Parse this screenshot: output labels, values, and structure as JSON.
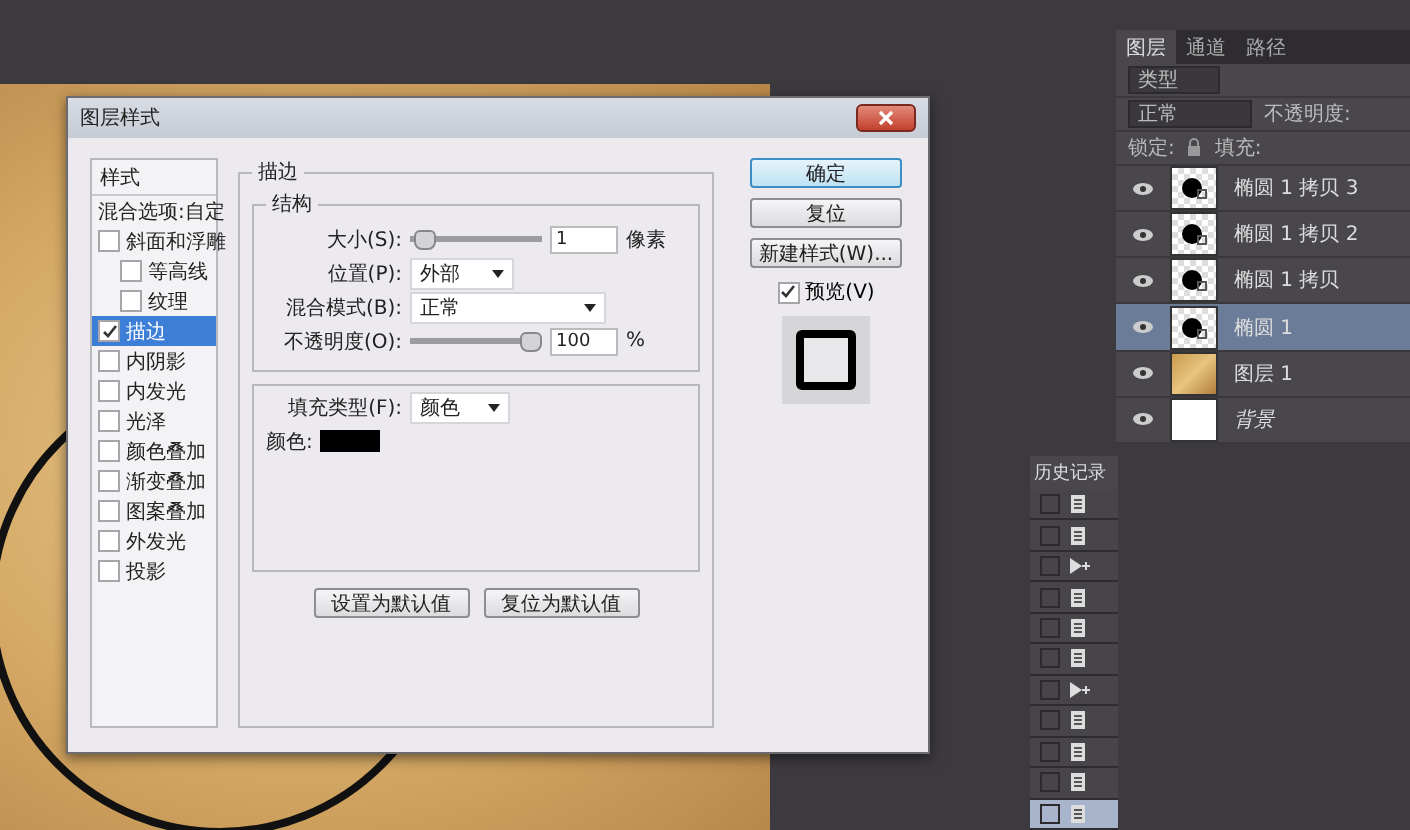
{
  "dialog": {
    "title": "图层样式",
    "styles_header": "样式",
    "blend_options": "混合选项:自定",
    "effects": [
      {
        "label": "斜面和浮雕",
        "checked": false,
        "selected": false,
        "children": [
          {
            "label": "等高线",
            "checked": false,
            "selected": false
          },
          {
            "label": "纹理",
            "checked": false,
            "selected": false
          }
        ]
      },
      {
        "label": "描边",
        "checked": true,
        "selected": true
      },
      {
        "label": "内阴影",
        "checked": false,
        "selected": false
      },
      {
        "label": "内发光",
        "checked": false,
        "selected": false
      },
      {
        "label": "光泽",
        "checked": false,
        "selected": false
      },
      {
        "label": "颜色叠加",
        "checked": false,
        "selected": false
      },
      {
        "label": "渐变叠加",
        "checked": false,
        "selected": false
      },
      {
        "label": "图案叠加",
        "checked": false,
        "selected": false
      },
      {
        "label": "外发光",
        "checked": false,
        "selected": false
      },
      {
        "label": "投影",
        "checked": false,
        "selected": false
      }
    ],
    "stroke": {
      "group_title": "描边",
      "structure_title": "结构",
      "size": {
        "label": "大小(S):",
        "value": "1",
        "unit": "像素",
        "level": 0.03
      },
      "position": {
        "label": "位置(P):",
        "value": "外部"
      },
      "blend_mode": {
        "label": "混合模式(B):",
        "value": "正常"
      },
      "opacity": {
        "label": "不透明度(O):",
        "value": "100",
        "unit": "%",
        "level": 1
      },
      "fill_type": {
        "label": "填充类型(F):",
        "value": "颜色"
      },
      "color_label": "颜色:"
    },
    "default_buttons": [
      "设置为默认值",
      "复位为默认值"
    ],
    "ok": "确定",
    "reset": "复位",
    "new_style": "新建样式(W)...",
    "preview": {
      "label": "预览(V)",
      "checked": true
    }
  },
  "layers_panel": {
    "tabs": [
      {
        "label": "图层",
        "selected": true
      },
      {
        "label": "通道",
        "selected": false
      },
      {
        "label": "路径",
        "selected": false
      }
    ],
    "filter": "类型",
    "blend": "正常",
    "opacity_label": "不透明度:",
    "lock_label": "锁定:",
    "fill_label": "填充:",
    "layers": [
      {
        "name": "椭圆 1 拷贝 3",
        "kind": "shape",
        "visible": true,
        "selected": false
      },
      {
        "name": "椭圆 1 拷贝 2",
        "kind": "shape",
        "visible": true,
        "selected": false
      },
      {
        "name": "椭圆 1 拷贝",
        "kind": "shape",
        "visible": true,
        "selected": false
      },
      {
        "name": "椭圆 1",
        "kind": "shape",
        "visible": true,
        "selected": true
      },
      {
        "name": "图层 1",
        "kind": "image",
        "visible": true,
        "selected": false
      },
      {
        "name": "背景",
        "kind": "background",
        "visible": true,
        "selected": false
      }
    ]
  },
  "history_panel": {
    "title": "历史记录",
    "rows": [
      {
        "kind": "document",
        "selected": false
      },
      {
        "kind": "document",
        "selected": false
      },
      {
        "kind": "move",
        "selected": false
      },
      {
        "kind": "document",
        "selected": false
      },
      {
        "kind": "document",
        "selected": false
      },
      {
        "kind": "document",
        "selected": false
      },
      {
        "kind": "move",
        "selected": false
      },
      {
        "kind": "document",
        "selected": false
      },
      {
        "kind": "document",
        "selected": false
      },
      {
        "kind": "document",
        "selected": false
      },
      {
        "kind": "document",
        "selected": true
      }
    ]
  }
}
